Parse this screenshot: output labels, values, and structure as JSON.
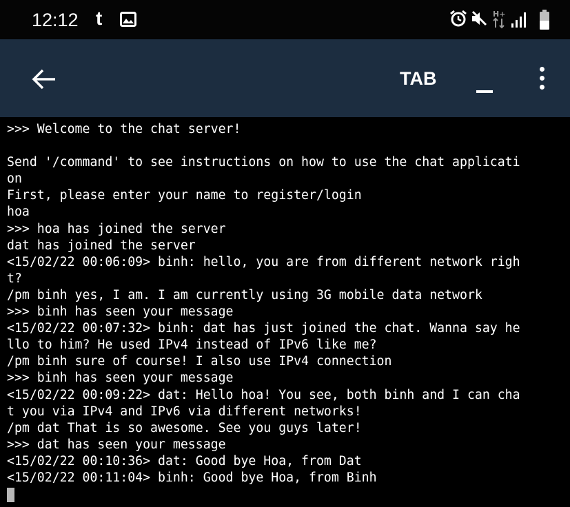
{
  "status_bar": {
    "time": "12:12",
    "left_icons": [
      "t-icon",
      "image-icon"
    ],
    "right_icons": [
      "alarm-icon",
      "mute-icon",
      "hplus-data-icon",
      "signal-icon",
      "battery-icon"
    ],
    "network_label": "H+"
  },
  "app_bar": {
    "back_icon": "back-arrow-icon",
    "tab_label": "TAB",
    "underscore_label": "_",
    "more_icon": "more-vert-icon",
    "background_color": "#1c2d40"
  },
  "terminal": {
    "lines": [
      ">>> Welcome to the chat server!",
      "",
      "Send '/command' to see instructions on how to use the chat applicati",
      "on",
      "First, please enter your name to register/login",
      "hoa",
      ">>> hoa has joined the server",
      "dat has joined the server",
      "<15/02/22 00:06:09> binh: hello, you are from different network righ",
      "t?",
      "/pm binh yes, I am. I am currently using 3G mobile data network",
      ">>> binh has seen your message",
      "<15/02/22 00:07:32> binh: dat has just joined the chat. Wanna say he",
      "llo to him? He used IPv4 instead of IPv6 like me?",
      "/pm binh sure of course! I also use IPv4 connection",
      ">>> binh has seen your message",
      "<15/02/22 00:09:22> dat: Hello hoa! You see, both binh and I can cha",
      "t you via IPv4 and IPv6 via different networks!",
      "/pm dat That is so awesome. See you guys later!",
      ">>> dat has seen your message",
      "<15/02/22 00:10:36> dat: Good bye Hoa, from Dat",
      "<15/02/22 00:11:04> binh: Good bye Hoa, from Binh"
    ]
  }
}
